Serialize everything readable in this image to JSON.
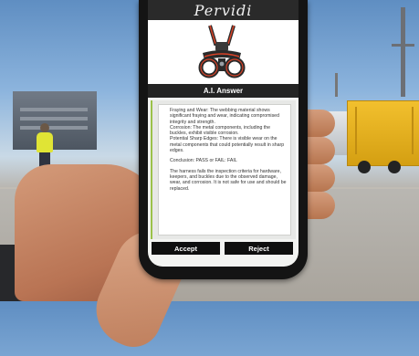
{
  "app": {
    "title": "Pervidi"
  },
  "product_image": {
    "icon": "safety-harness-icon"
  },
  "answer": {
    "title": "A.I. Answer",
    "paragraphs": [
      "Fraying and Wear: The webbing material shows significant fraying and wear, indicating compromised integrity and strength.",
      "Corrosion: The metal components, including the buckles, exhibit visible corrosion.",
      "Potential Sharp Edges: There is visible wear on the metal components that could potentially result in sharp edges.",
      "Conclusion: PASS or FAIL: FAIL",
      "The harness fails the inspection criteria for hardware, keepers, and buckles due to the observed damage, wear, and corrosion. It is not safe for use and should be replaced."
    ]
  },
  "actions": {
    "accept_label": "Accept",
    "reject_label": "Reject"
  },
  "colors": {
    "header": "#2a2a2a",
    "panel_accent": "#9bc24a",
    "button": "#0f0f0f",
    "harness_accent": "#d84227"
  }
}
